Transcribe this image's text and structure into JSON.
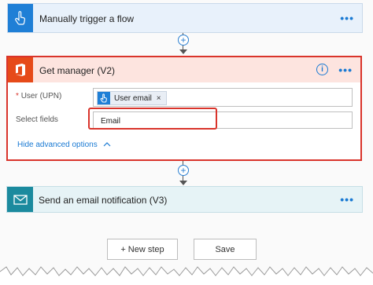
{
  "flow": {
    "trigger": {
      "title": "Manually trigger a flow",
      "icon": "touch-hand-icon",
      "menu_label": "•••"
    },
    "action1": {
      "title": "Get manager (V2)",
      "icon": "office-icon",
      "info_label": "i",
      "menu_label": "•••",
      "fields": {
        "user": {
          "label": "User (UPN)",
          "required_mark": "*",
          "token_label": "User email",
          "token_remove": "×"
        },
        "select": {
          "label": "Select fields",
          "value": "Email"
        }
      },
      "advanced_link": "Hide advanced options",
      "advanced_icon": "chevron-up-icon"
    },
    "action2": {
      "title": "Send an email notification (V3)",
      "icon": "mail-icon",
      "menu_label": "•••"
    }
  },
  "connectors": [
    {
      "add_label": "+"
    },
    {
      "add_label": "+"
    }
  ],
  "buttons": {
    "new_step": "+ New step",
    "save": "Save"
  },
  "colors": {
    "accent": "#1a7ad3",
    "trigger_icon_bg": "#1f7fd6",
    "office_icon_bg": "#e64a19",
    "mail_icon_bg": "#1b8a9e",
    "highlight_red": "#d9342b"
  }
}
